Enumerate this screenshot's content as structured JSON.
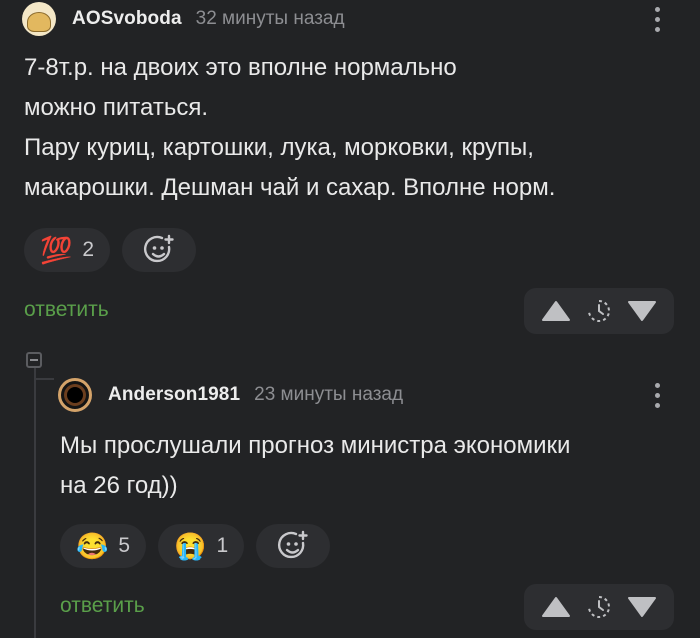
{
  "comments": [
    {
      "author": "AOSvoboda",
      "time": "32 минуты назад",
      "lines": [
        "7-8т.р. на двоих это вполне нормально",
        "можно питаться.",
        "Пару куриц, картошки, лука, морковки, крупы,",
        "макарошки. Дешман чай и сахар. Вполне норм."
      ],
      "reactions": [
        {
          "icon": "hundred-points-icon",
          "glyph": "💯",
          "count": "2"
        }
      ],
      "reply_label": "ответить"
    },
    {
      "author": "Anderson1981",
      "time": "23 минуты назад",
      "lines": [
        "Мы прослушали прогноз министра экономики",
        "на 26 год))"
      ],
      "reactions": [
        {
          "icon": "tears-of-joy-icon",
          "glyph": "😂",
          "count": "5"
        },
        {
          "icon": "loudly-crying-icon",
          "glyph": "😭",
          "count": "1"
        }
      ],
      "reply_label": "ответить"
    }
  ],
  "colors": {
    "background": "#222325",
    "reply_link": "#5a9f4a",
    "muted_text": "#8d8e92"
  }
}
